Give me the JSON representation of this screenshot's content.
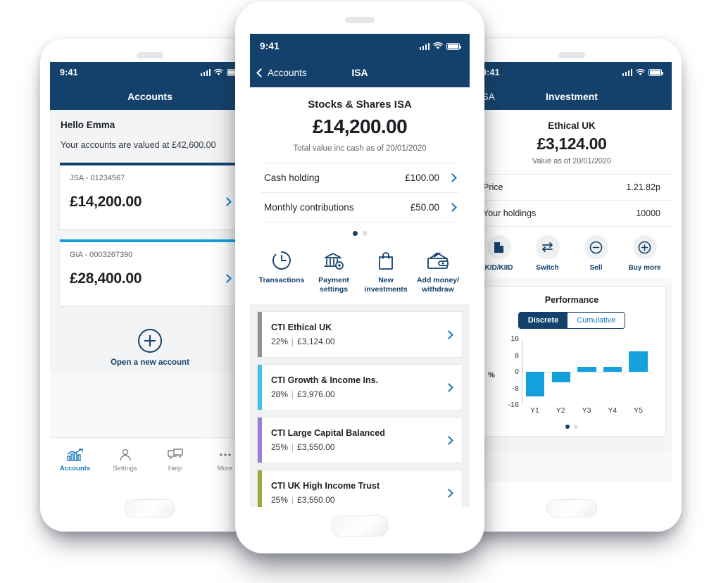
{
  "phones": {
    "left": {
      "status": {
        "time": "9:41"
      },
      "navbar": {
        "title": "Accounts"
      },
      "greeting": "Hello Emma",
      "greeting_sub": "Your accounts are valued at £42,600.00",
      "accounts": [
        {
          "label": "JSA - 01234567",
          "amount": "£14,200.00",
          "accent": "#13416b"
        },
        {
          "label": "GIA - 0003267390",
          "amount": "£28,400.00",
          "accent": "#14a0dc"
        }
      ],
      "open_new_label": "Open a new account",
      "tabs": [
        {
          "label": "Accounts",
          "icon": "chart-growth-icon"
        },
        {
          "label": "Settings",
          "icon": "person-icon"
        },
        {
          "label": "Help",
          "icon": "chat-bubbles-icon"
        },
        {
          "label": "More",
          "icon": "ellipsis-icon"
        }
      ]
    },
    "center": {
      "status": {
        "time": "9:41"
      },
      "navbar": {
        "back_label": "Accounts",
        "title": "ISA"
      },
      "hero": {
        "name": "Stocks & Shares ISA",
        "total": "£14,200.00",
        "as_of": "Total value inc cash as of 20/01/2020"
      },
      "rows": [
        {
          "key": "Cash holding",
          "value": "£100.00"
        },
        {
          "key": "Monthly contributions",
          "value": "£50.00"
        }
      ],
      "carousel": {
        "count": 2,
        "active": 0
      },
      "quick_actions": [
        {
          "label": "Transactions",
          "icon": "clock-history-icon"
        },
        {
          "label": "Payment settings",
          "icon": "bank-gear-icon"
        },
        {
          "label": "New investments",
          "icon": "shopping-bag-icon"
        },
        {
          "label": "Add money/ withdraw",
          "icon": "wallet-icon"
        }
      ],
      "funds": [
        {
          "name": "CTI Ethical UK",
          "percent": "22%",
          "value": "£3,124.00",
          "accent": "#8e9398"
        },
        {
          "name": "CTI Growth & Income Ins.",
          "percent": "28%",
          "value": "£3,976.00",
          "accent": "#45c0ea"
        },
        {
          "name": "CTI Large Capital Balanced",
          "percent": "25%",
          "value": "£3,550.00",
          "accent": "#9b7fd4"
        },
        {
          "name": "CTI UK High Income Trust",
          "percent": "25%",
          "value": "£3,550.00",
          "accent": "#9aab3e"
        }
      ]
    },
    "right": {
      "status": {
        "time": "9:41"
      },
      "navbar": {
        "back_label": "ISA",
        "title": "Investment"
      },
      "hero": {
        "name": "Ethical UK",
        "total": "£3,124.00",
        "as_of": "Value as of 20/01/2020"
      },
      "rows": [
        {
          "key": "Price",
          "value": "1.21.82p"
        },
        {
          "key": "Your holdings",
          "value": "10000"
        }
      ],
      "actions": [
        {
          "label": "KID/KIID",
          "icon": "document-icon"
        },
        {
          "label": "Switch",
          "icon": "switch-arrows-icon"
        },
        {
          "label": "Sell",
          "icon": "minus-circle-icon"
        },
        {
          "label": "Buy more",
          "icon": "plus-circle-icon"
        }
      ],
      "performance": {
        "title": "Performance",
        "segments": [
          {
            "label": "Discrete",
            "selected": true
          },
          {
            "label": "Cumulative",
            "selected": false
          }
        ],
        "carousel": {
          "count": 2,
          "active": 0
        }
      }
    }
  },
  "colors": {
    "navy": "#13416b",
    "blue": "#1878b9",
    "cyan": "#14a0dc",
    "screen_bg": "#f7f8f9"
  },
  "chart_data": {
    "type": "bar",
    "title": "Performance",
    "categories": [
      "Y1",
      "Y2",
      "Y3",
      "Y4",
      "Y5"
    ],
    "values": [
      -12,
      -5,
      2.5,
      2.5,
      10
    ],
    "xlabel": "",
    "ylabel": "%",
    "ylim": [
      -16,
      16
    ],
    "yticks": [
      16,
      8,
      0,
      -8,
      -16
    ],
    "grid": false,
    "legend": false,
    "series_color": "#14a0dc"
  }
}
